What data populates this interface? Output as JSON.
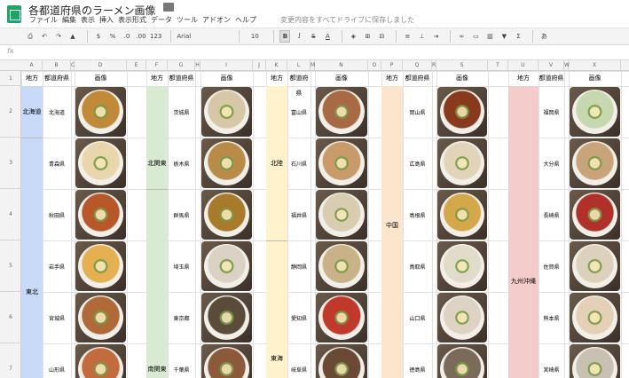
{
  "doc_title": "各都道府県のラーメン画像",
  "menu": [
    "ファイル",
    "編集",
    "表示",
    "挿入",
    "表示形式",
    "データ",
    "ツール",
    "アドオン",
    "ヘルプ"
  ],
  "saved_status": "変更内容をすべてドライブに保存しました",
  "toolbar": {
    "percent": "%",
    "dec0": ".0",
    "dec00": ".00",
    "numfmt": "123",
    "font": "Arial",
    "size": "10",
    "bold": "B",
    "italic": "I",
    "strike": "S",
    "textcolor": "A",
    "more": "あ"
  },
  "fx": "fx",
  "columns": [
    "A",
    "B",
    "C",
    "D",
    "E",
    "F",
    "G",
    "H",
    "I",
    "J",
    "K",
    "L",
    "M",
    "N",
    "O",
    "P",
    "Q",
    "R",
    "S",
    "T",
    "U",
    "V",
    "W",
    "X"
  ],
  "rows": [
    "1",
    "2",
    "3",
    "4",
    "5",
    "6",
    "7"
  ],
  "headers": {
    "region": "地方",
    "pref": "都道府県",
    "image": "画像"
  },
  "groups": [
    {
      "regions": [
        "北海道",
        "東北"
      ],
      "color": "#c9daf8",
      "prefs": [
        "北海道",
        "青森県",
        "秋田県",
        "岩手県",
        "宮城県",
        "山形県"
      ]
    },
    {
      "regions": [
        "北関東",
        "南関東"
      ],
      "color": "#d9ead3",
      "prefs": [
        "茨城県",
        "栃木県",
        "群馬県",
        "埼玉県",
        "東京都",
        "千葉県"
      ]
    },
    {
      "regions": [
        "北陸",
        "東海"
      ],
      "color": "#fff2cc",
      "prefs": [
        "富山県",
        "石川県",
        "福井県",
        "静岡県",
        "愛知県",
        "岐阜県"
      ]
    },
    {
      "regions": [
        "中国"
      ],
      "color": "#fce5cd",
      "prefs": [
        "岡山県",
        "広島県",
        "島根県",
        "鳥取県",
        "山口県",
        "徳島県"
      ]
    },
    {
      "regions": [
        "九州沖縄"
      ],
      "color": "#f4cccc",
      "prefs": [
        "福岡県",
        "大分県",
        "長崎県",
        "佐賀県",
        "熊本県",
        "宮崎県"
      ]
    }
  ],
  "photo_colors": [
    [
      "#c08a3a",
      "#e9d6ac",
      "#b8582a",
      "#e4b052",
      "#b06a3a",
      "#c26b3e"
    ],
    [
      "#d6c8a6",
      "#b98b49",
      "#a87a2c",
      "#d9d2c5",
      "#5a4b3b",
      "#8b5a3a"
    ],
    [
      "#a86a44",
      "#c99a6a",
      "#d8cdb0",
      "#c9b188",
      "#c0392b",
      "#6a4a34"
    ],
    [
      "#8a3a1c",
      "#e1d4b8",
      "#d4a84a",
      "#e0dcc9",
      "#ddd2c4",
      "#7a6a5a"
    ],
    [
      "#c7d8b0",
      "#c9a47a",
      "#b0312a",
      "#ddd0bc",
      "#e4d0b6",
      "#c8c0b0"
    ]
  ]
}
